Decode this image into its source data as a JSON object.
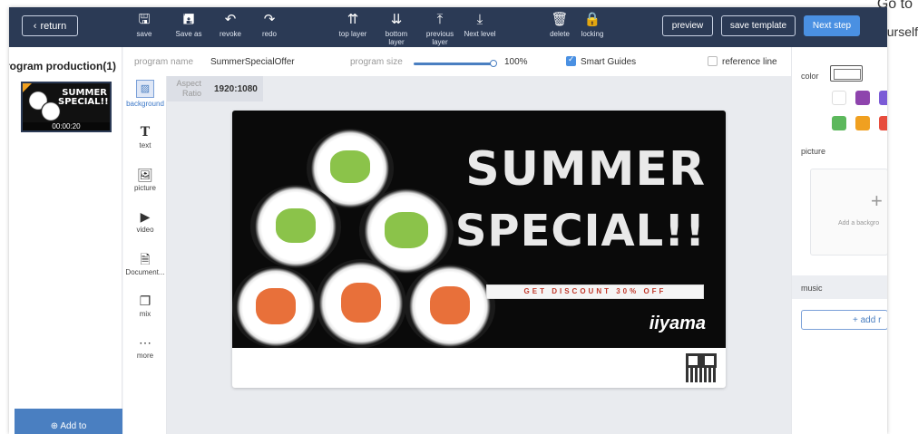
{
  "behind": {
    "goto": "Go to",
    "urself": "urself"
  },
  "toolbar": {
    "return_label": "return",
    "tools": [
      {
        "label": "save",
        "icon": "save-icon",
        "glyph": "🖫"
      },
      {
        "label": "Save as",
        "icon": "save-as-icon",
        "glyph": "🖪"
      },
      {
        "label": "revoke",
        "icon": "undo-icon",
        "glyph": "↶"
      },
      {
        "label": "redo",
        "icon": "redo-icon",
        "glyph": "↷"
      },
      {
        "label": "top layer",
        "icon": "top-layer-icon",
        "glyph": "⇈"
      },
      {
        "label": "bottom layer",
        "icon": "bottom-layer-icon",
        "glyph": "⇊"
      },
      {
        "label": "previous layer",
        "icon": "previous-layer-icon",
        "glyph": "⤒"
      },
      {
        "label": "Next level",
        "icon": "next-level-icon",
        "glyph": "⤓"
      },
      {
        "label": "delete",
        "icon": "delete-icon",
        "glyph": "🗑"
      },
      {
        "label": "locking",
        "icon": "lock-icon",
        "glyph": "🔒"
      }
    ],
    "preview_label": "preview",
    "save_template_label": "save template",
    "next_step_label": "Next step"
  },
  "left_panel": {
    "title": "rogram production(1)",
    "thumb_title": "SUMMER SPECIAL!!",
    "thumb_duration": "00:00:20",
    "add_to_label": "⊕ Add to"
  },
  "vertical_tools": [
    {
      "label": "background",
      "icon": "background-icon",
      "glyph": "▨",
      "active": true
    },
    {
      "label": "text",
      "icon": "text-icon",
      "glyph": "T",
      "active": false
    },
    {
      "label": "picture",
      "icon": "picture-icon",
      "glyph": "🖼",
      "active": false
    },
    {
      "label": "video",
      "icon": "video-icon",
      "glyph": "▶",
      "active": false
    },
    {
      "label": "Document...",
      "icon": "document-icon",
      "glyph": "🗎",
      "active": false
    },
    {
      "label": "mix",
      "icon": "mix-icon",
      "glyph": "❐",
      "active": false
    },
    {
      "label": "more",
      "icon": "more-icon",
      "glyph": "⋯",
      "active": false
    }
  ],
  "options": {
    "program_name_label": "program name",
    "program_name_value": "SummerSpecialOffer",
    "program_size_label": "program size",
    "program_size_value": "100%",
    "program_size_fraction": 1.0,
    "smart_guides_label": "Smart Guides",
    "smart_guides_checked": true,
    "reference_line_label": "reference line",
    "reference_line_checked": false
  },
  "canvas": {
    "aspect_label": "Aspect Ratio",
    "aspect_value": "1920:1080",
    "banner": {
      "line1": "SUMMER",
      "line2": "SPECIAL!!",
      "discount": "GET DISCOUNT 30% OFF",
      "brand": "iiyama"
    }
  },
  "right_panel": {
    "color_label": "color",
    "swatches": [
      "#ffffff",
      "#8e44ad",
      "#7b5bd6",
      "#5cb85c",
      "#f0a020",
      "#e74c3c"
    ],
    "picture_label": "picture",
    "add_background_label": "Add a backgro",
    "music_label": "music",
    "add_music_label": "+ add r"
  },
  "colors": {
    "topbar": "#2b3a55",
    "accent": "#4a90e2",
    "canvas_bg": "#e9ebef"
  }
}
